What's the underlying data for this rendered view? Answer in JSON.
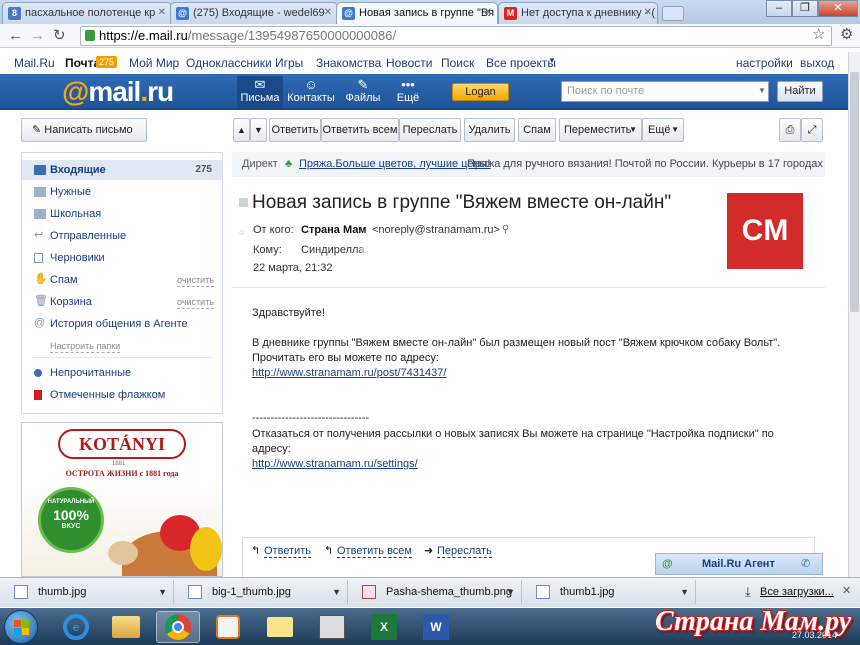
{
  "browser": {
    "tabs": [
      {
        "label": "пасхальное полотенце кр",
        "fav": "8",
        "fav_color": "#4a78c4"
      },
      {
        "label": "(275) Входящие - wedel69",
        "fav": "@",
        "fav_color": "#3d7ad6"
      },
      {
        "label": "Новая запись в группе \"Вя",
        "fav": "@",
        "fav_color": "#3d7ad6"
      },
      {
        "label": "Нет доступа к дневнику - (",
        "fav": "M",
        "fav_color": "#d22"
      }
    ],
    "url_host": "https://e.mail.ru",
    "url_path": "/message/13954987650000000086/"
  },
  "topnav": {
    "left": [
      "Mail.Ru",
      "Почта",
      "Мой Мир",
      "Одноклассники",
      "Игры",
      "Знакомства",
      "Новости",
      "Поиск",
      "Все проекты"
    ],
    "pochta_count": "275",
    "settings": "настройки",
    "exit": "выход"
  },
  "header": {
    "logo": "@mail.ru",
    "nav": [
      {
        "label": "Письма",
        "icon": "envelope-icon"
      },
      {
        "label": "Контакты",
        "icon": "contacts-icon"
      },
      {
        "label": "Файлы",
        "icon": "paperclip-icon"
      },
      {
        "label": "Ещё",
        "icon": "more-dots-icon"
      }
    ],
    "logan": "Logan",
    "search_placeholder": "Поиск по почте",
    "find": "Найти"
  },
  "compose": "Написать письмо",
  "actions": [
    "Ответить",
    "Ответить всем",
    "Переслать",
    "Удалить",
    "Спам",
    "Переместить",
    "Ещё"
  ],
  "folders": [
    {
      "label": "Входящие",
      "count": "275",
      "icon": "inbox-icon"
    },
    {
      "label": "Нужные",
      "icon": "folder-icon"
    },
    {
      "label": "Школьная",
      "icon": "folder-icon"
    },
    {
      "label": "Отправленные",
      "icon": "sent-icon"
    },
    {
      "label": "Черновики",
      "icon": "draft-icon"
    },
    {
      "label": "Спам",
      "clean": "очистить",
      "icon": "spam-icon"
    },
    {
      "label": "Корзина",
      "clean": "очистить",
      "icon": "trash-icon"
    },
    {
      "label": "История общения в Агенте",
      "icon": "agent-icon"
    }
  ],
  "configure_folders": "Настроить папки",
  "filters": [
    {
      "label": "Непрочитанные",
      "icon": "unread-icon"
    },
    {
      "label": "Отмеченные флажком",
      "icon": "flag-icon"
    }
  ],
  "ad": {
    "brand": "KOTÁNYI",
    "since": "1881",
    "tagline": "ОСТРОТА ЖИЗНИ с 1881 года",
    "badge_top": "НАТУРАЛЬНЫЙ",
    "badge_mid": "100%",
    "badge_bottom": "ВКУС"
  },
  "direct": {
    "label": "Директ",
    "link": "Пряжа.Больше цветов, лучшие цены!",
    "text": "Пряжа для ручного вязания! Почтой по России. Курьеры в 17 городах"
  },
  "message": {
    "subject": "Новая запись в группе \"Вяжем вместе он-лайн\"",
    "from_label": "От кого:",
    "from_name": "Страна Мам",
    "from_email": "<noreply@stranamam.ru>",
    "to_label": "Кому:",
    "to_name": "Синдирелла1",
    "date": "22 марта, 21:32",
    "avatar": "CM",
    "greeting": "Здравствуйте!",
    "p1_line1": "В дневнике группы \"Вяжем вместе он-лайн\" был размещен новый пост \"Вяжем крючком собаку Вольт\".",
    "p1_line2": "Прочитать его вы можете по адресу:",
    "link1": "http://www.stranamam.ru/post/7431437/",
    "divider": "--------------------------------",
    "p2_line1": "Отказаться от получения рассылки о новых записях Вы можете на странице \"Настройка подписки\" по",
    "p2_line2": "адресу:",
    "link2": "http://www.stranamam.ru/settings/"
  },
  "reply_links": [
    "Ответить",
    "Ответить всем",
    "Переслать"
  ],
  "agent": "Mail.Ru Агент",
  "downloads": [
    "thumb.jpg",
    "big-1_thumb.jpg",
    "Pasha-shema_thumb.png",
    "thumb1.jpg"
  ],
  "all_downloads": "Все загрузки...",
  "watermark": "Страна Мам.ру",
  "clock_date": "27.03.2014"
}
